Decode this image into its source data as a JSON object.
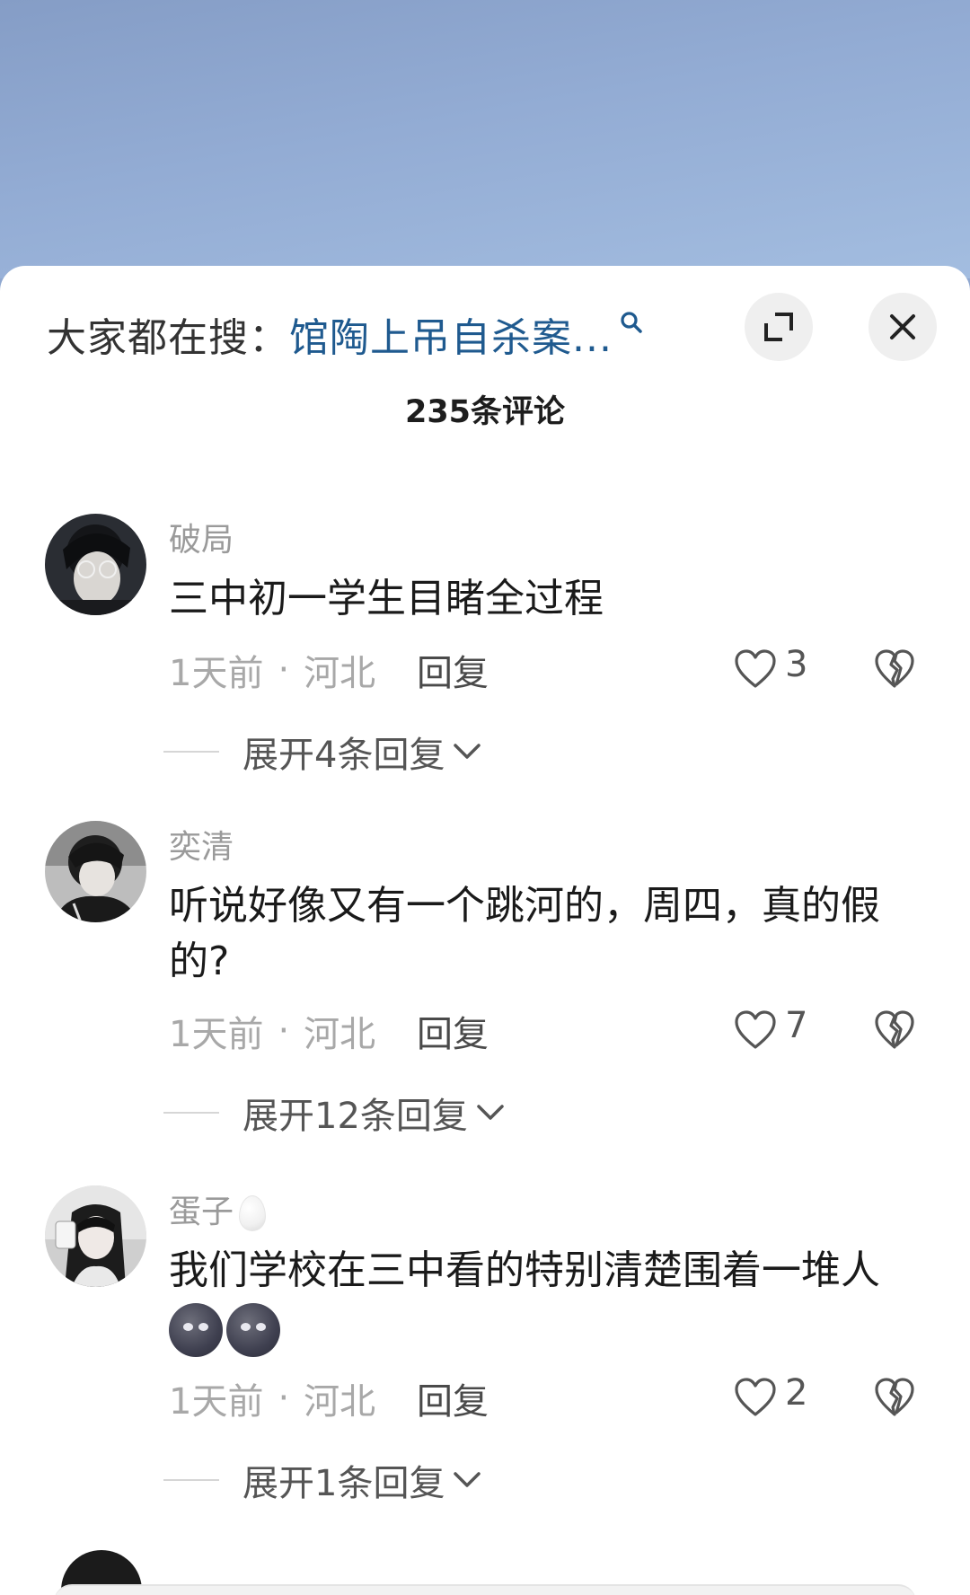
{
  "search": {
    "prefix": "大家都在搜：",
    "term": "馆陶上吊自杀案...",
    "icon": "search-icon"
  },
  "header": {
    "expand_icon": "expand-icon",
    "close_icon": "close-icon",
    "count_title": "235条评论"
  },
  "comments": [
    {
      "username": "破局",
      "text": "三中初一学生目睹全过程",
      "time": "1天前",
      "location": "河北",
      "reply_label": "回复",
      "likes": "3",
      "expand_label": "展开4条回复"
    },
    {
      "username": "奕清",
      "text": "听说好像又有一个跳河的，周四，真的假的?",
      "time": "1天前",
      "location": "河北",
      "reply_label": "回复",
      "likes": "7",
      "expand_label": "展开12条回复"
    },
    {
      "username": "蛋子",
      "text": "我们学校在三中看的特别清楚围着一堆人",
      "time": "1天前",
      "location": "河北",
      "reply_label": "回复",
      "likes": "2",
      "expand_label": "展开1条回复"
    }
  ],
  "meta_separator": "·",
  "colors": {
    "search_term": "#1f5a8f",
    "sky_top": "#859dc6",
    "sky_bottom": "#a3bde0"
  }
}
